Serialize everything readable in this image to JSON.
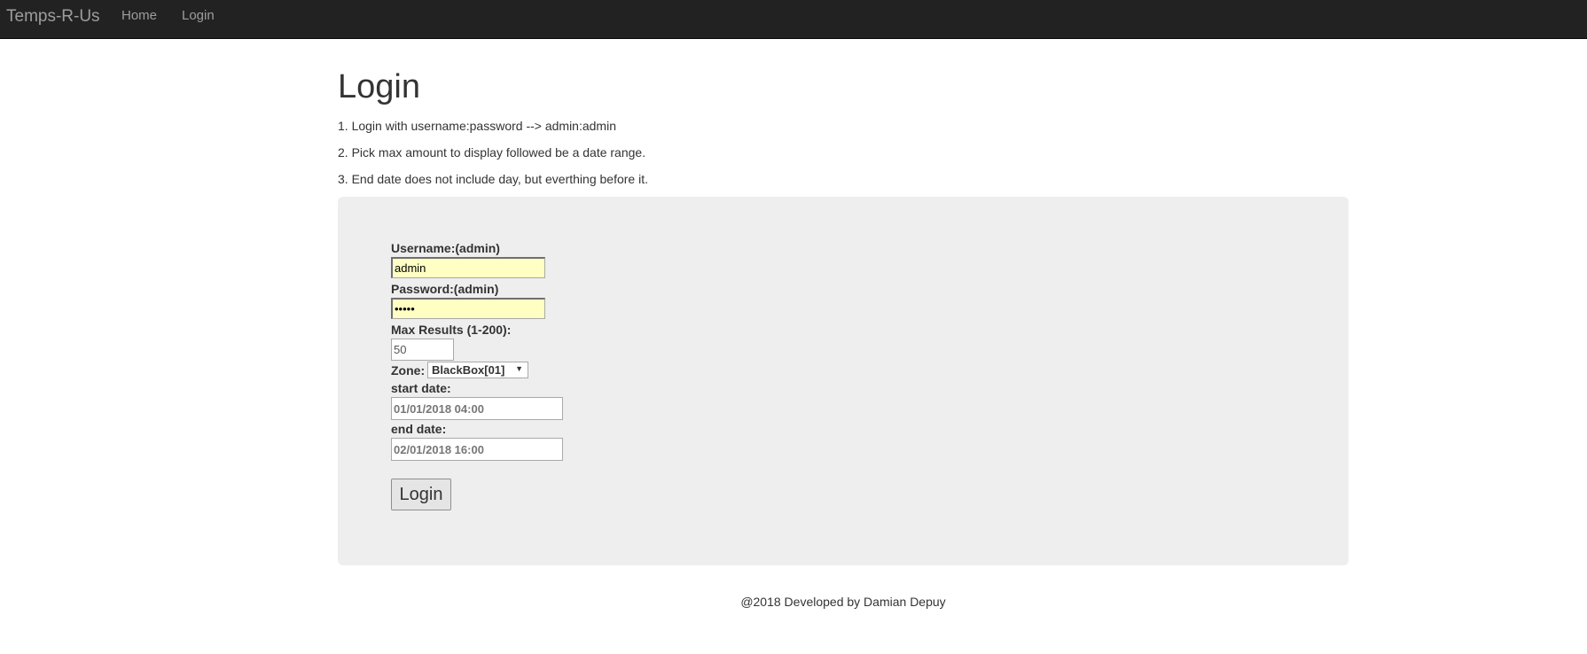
{
  "navbar": {
    "brand": "Temps-R-Us",
    "links": [
      {
        "label": "Home"
      },
      {
        "label": "Login"
      }
    ]
  },
  "main": {
    "title": "Login",
    "instructions": [
      "1. Login with username:password --> admin:admin",
      "2. Pick max amount to display followed be a date range.",
      "3. End date does not include day, but everthing before it."
    ]
  },
  "form": {
    "username_label": "Username:(admin)",
    "username_value": "admin",
    "password_label": "Password:(admin)",
    "password_value": "admin",
    "max_results_label": "Max Results (1-200):",
    "max_results_value": "50",
    "zone_label": "Zone:",
    "zone_selected": "BlackBox[01]",
    "start_date_label": "start date:",
    "start_date_value": "01/01/2018 04:00",
    "end_date_label": "end date:",
    "end_date_value": "02/01/2018 16:00",
    "submit_label": "Login"
  },
  "footer": {
    "text": "@2018 Developed by Damian Depuy"
  },
  "colors": {
    "navbar_bg": "#222222",
    "navbar_text": "#9d9d9d",
    "panel_bg": "#eeeeee",
    "autofill_bg": "#ffffc4"
  }
}
